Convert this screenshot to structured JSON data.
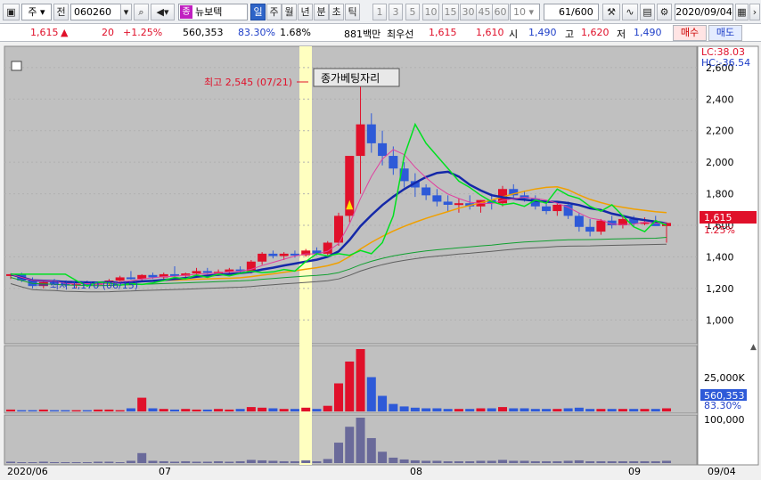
{
  "toolbar": {
    "market": "주",
    "prefix": "전",
    "code": "060260",
    "name": "뉴보텍",
    "name_badge": "종",
    "periods": [
      "일",
      "주",
      "월",
      "년",
      "분",
      "초",
      "틱"
    ],
    "active_period": "일",
    "intervals": [
      "1",
      "3",
      "5",
      "10",
      "15",
      "30",
      "45",
      "60"
    ],
    "interval_value": "10",
    "count_value": "61",
    "count_total": "/600",
    "date": "2020/09/04"
  },
  "quote": {
    "price": "1,615",
    "change_arrow": "▲",
    "change": "20",
    "change_pct": "+1.25%",
    "volume": "560,353",
    "vol_ratio": "83.30%",
    "turnover": "1.68%",
    "amount": "881백만",
    "best_label": "최우선",
    "ask": "1,615",
    "bid": "1,610",
    "open_label": "시",
    "open": "1,490",
    "high_label": "고",
    "high": "1,620",
    "low_label": "저",
    "low": "1,490",
    "buy_label": "매수",
    "sell_label": "매도"
  },
  "chart_data": {
    "type": "candlestick",
    "annotations": {
      "high": "최고 2,545 (07/21)",
      "low": "최저 1,170 (06/15)",
      "box": "종가베팅자리",
      "lc": "LC:38.03",
      "hc": "HC:-36.54"
    },
    "price_axis": [
      "2,600",
      "2,400",
      "2,200",
      "2,000",
      "1,800",
      "1,600",
      "1,400",
      "1,200",
      "1,000"
    ],
    "current_price": "1,615",
    "current_pct": "1.25%",
    "volume_axis": [
      "25,000K"
    ],
    "volume_current": "560,353",
    "volume_pct": "83.30%",
    "lower_axis": [
      "100,000"
    ],
    "x_labels": [
      "2020/06",
      "07",
      "08",
      "09",
      "09/04"
    ],
    "ylim": [
      900,
      2650
    ],
    "candles": [
      [
        1280,
        1295,
        1260,
        1290
      ],
      [
        1290,
        1300,
        1240,
        1250
      ],
      [
        1250,
        1270,
        1200,
        1215
      ],
      [
        1215,
        1250,
        1200,
        1240
      ],
      [
        1240,
        1260,
        1230,
        1235
      ],
      [
        1235,
        1250,
        1210,
        1220
      ],
      [
        1220,
        1240,
        1200,
        1230
      ],
      [
        1230,
        1250,
        1215,
        1225
      ],
      [
        1225,
        1245,
        1210,
        1235
      ],
      [
        1235,
        1260,
        1220,
        1250
      ],
      [
        1250,
        1280,
        1240,
        1270
      ],
      [
        1270,
        1310,
        1255,
        1260
      ],
      [
        1260,
        1290,
        1245,
        1285
      ],
      [
        1285,
        1300,
        1260,
        1270
      ],
      [
        1270,
        1300,
        1250,
        1290
      ],
      [
        1290,
        1340,
        1260,
        1280
      ],
      [
        1280,
        1300,
        1265,
        1295
      ],
      [
        1295,
        1330,
        1280,
        1310
      ],
      [
        1310,
        1330,
        1290,
        1300
      ],
      [
        1300,
        1320,
        1280,
        1305
      ],
      [
        1305,
        1330,
        1290,
        1320
      ],
      [
        1320,
        1340,
        1300,
        1310
      ],
      [
        1310,
        1380,
        1295,
        1370
      ],
      [
        1370,
        1430,
        1350,
        1420
      ],
      [
        1420,
        1440,
        1390,
        1405
      ],
      [
        1405,
        1430,
        1380,
        1420
      ],
      [
        1420,
        1440,
        1395,
        1410
      ],
      [
        1410,
        1450,
        1400,
        1440
      ],
      [
        1440,
        1460,
        1410,
        1420
      ],
      [
        1420,
        1500,
        1410,
        1490
      ],
      [
        1490,
        1680,
        1470,
        1660
      ],
      [
        1660,
        1900,
        1620,
        2040
      ],
      [
        2040,
        2545,
        1800,
        2240
      ],
      [
        2240,
        2310,
        2060,
        2120
      ],
      [
        2120,
        2200,
        1980,
        2040
      ],
      [
        2040,
        2100,
        1920,
        1960
      ],
      [
        1960,
        2000,
        1840,
        1880
      ],
      [
        1880,
        1930,
        1780,
        1840
      ],
      [
        1840,
        1860,
        1760,
        1790
      ],
      [
        1790,
        1830,
        1720,
        1750
      ],
      [
        1750,
        1790,
        1690,
        1730
      ],
      [
        1730,
        1770,
        1680,
        1740
      ],
      [
        1740,
        1790,
        1700,
        1720
      ],
      [
        1720,
        1760,
        1680,
        1760
      ],
      [
        1760,
        1800,
        1700,
        1740
      ],
      [
        1740,
        1850,
        1720,
        1830
      ],
      [
        1830,
        1860,
        1770,
        1790
      ],
      [
        1790,
        1820,
        1750,
        1770
      ],
      [
        1770,
        1790,
        1700,
        1720
      ],
      [
        1720,
        1740,
        1670,
        1690
      ],
      [
        1690,
        1740,
        1660,
        1730
      ],
      [
        1730,
        1750,
        1640,
        1660
      ],
      [
        1660,
        1680,
        1560,
        1590
      ],
      [
        1590,
        1640,
        1530,
        1560
      ],
      [
        1560,
        1640,
        1540,
        1630
      ],
      [
        1630,
        1660,
        1580,
        1600
      ],
      [
        1600,
        1660,
        1580,
        1640
      ],
      [
        1640,
        1660,
        1590,
        1610
      ],
      [
        1610,
        1650,
        1600,
        1620
      ],
      [
        1620,
        1660,
        1600,
        1595
      ],
      [
        1595,
        1620,
        1490,
        1615
      ]
    ],
    "volumes": [
      3,
      2,
      2,
      3,
      2,
      2,
      2,
      2,
      3,
      3,
      2,
      5,
      22,
      5,
      4,
      3,
      4,
      3,
      3,
      4,
      3,
      4,
      7,
      6,
      5,
      4,
      4,
      6,
      4,
      9,
      45,
      80,
      100,
      55,
      25,
      12,
      8,
      6,
      5,
      5,
      4,
      4,
      4,
      5,
      5,
      7,
      5,
      5,
      4,
      4,
      4,
      5,
      6,
      4,
      4,
      4,
      4,
      4,
      4,
      4,
      5
    ]
  },
  "colors": {
    "up": "#e0102a",
    "down": "#2e5ad8",
    "bg": "#c0c0c0",
    "ma5": "#e040a0",
    "ma20": "#1428a8",
    "ma60": "#f0a000",
    "ma120": "#10a030",
    "ma240": "#606060",
    "line": "#00e020"
  }
}
